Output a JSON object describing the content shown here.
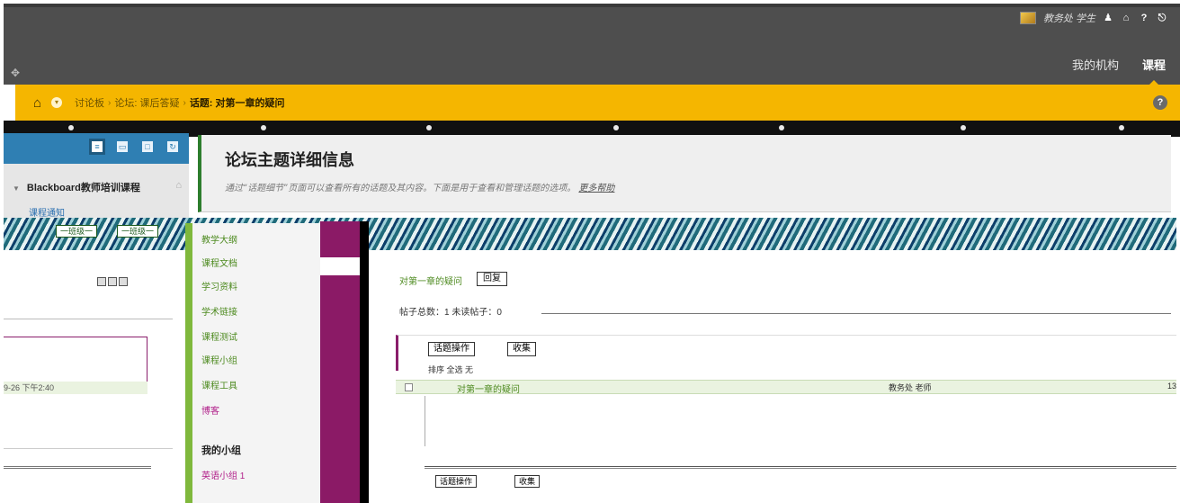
{
  "header": {
    "user_name": "教务处 学生",
    "icons": [
      "user-icon",
      "home-icon",
      "help-icon",
      "logout-icon"
    ],
    "tabs": [
      {
        "label": "我的机构",
        "active": false
      },
      {
        "label": "课程",
        "active": true
      }
    ]
  },
  "breadcrumb": {
    "items": [
      "讨论板",
      "论坛: 课后答疑"
    ],
    "current": "话题: 对第一章的疑问"
  },
  "course_menu": {
    "course_title": "Blackboard教师培训课程",
    "first_link": "课程通知"
  },
  "page_heading": {
    "title": "论坛主题详细信息",
    "description": "通过“话题细节”页面可以查看所有的话题及其内容。下面是用于查看和管理话题的选项。",
    "more_help": "更多帮助"
  },
  "left_fragment": {
    "glitch_tab_1": "一班级一",
    "glitch_tab_2": "一班级一",
    "date_text": "9-26 下午2:40"
  },
  "mid_menu": {
    "items": [
      "教学大纲",
      "课程文档",
      "学习资料",
      "学术链接",
      "课程测试",
      "课程小组",
      "课程工具",
      "博客"
    ],
    "groups_label": "我的小组",
    "group_item": "英语小组 1"
  },
  "thread": {
    "title": "对第一章的疑问",
    "reply_label": "回复",
    "meta_text": "帖子总数：1   未读帖子：0",
    "action_label": "话题操作",
    "collect_label": "收集",
    "sort_text": "排序  全选  无",
    "row": {
      "title": "对第一章的疑问",
      "author": "教务处 老师",
      "number": "13"
    },
    "bottom_action_label": "话题操作",
    "bottom_collect_label": "收集"
  },
  "colors": {
    "header_bg": "#4e4e4e",
    "breadcrumb_bg": "#f5b600",
    "menu_green": "#7fb83c",
    "accent_magenta": "#8b1a66",
    "link_blue": "#2a6fb0"
  }
}
